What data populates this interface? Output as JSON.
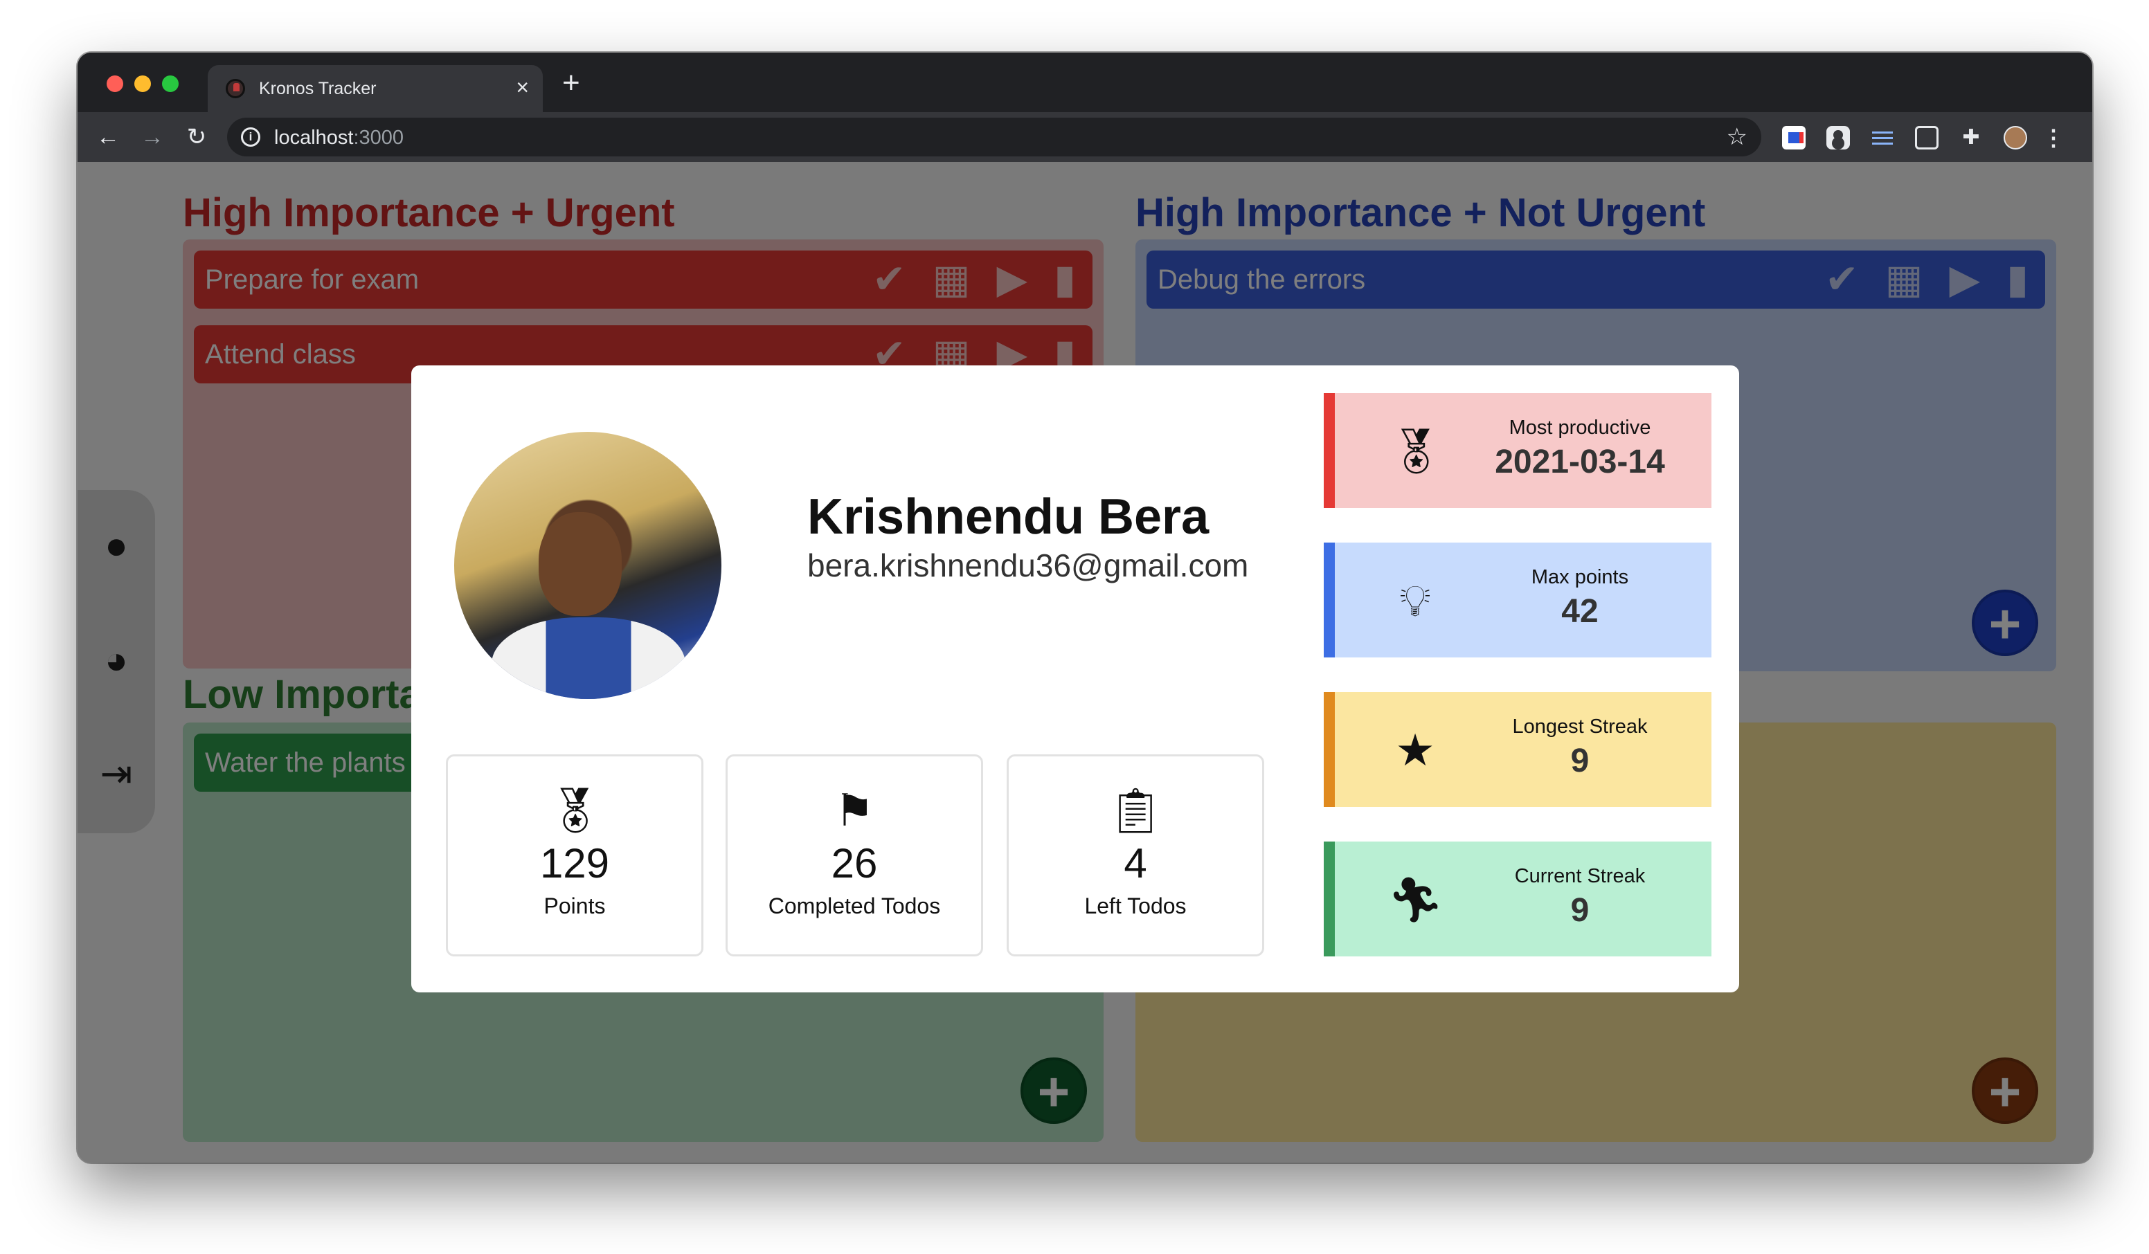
{
  "browser": {
    "tab_title": "Kronos Tracker",
    "tab_close": "×",
    "new_tab": "+",
    "url_host": "localhost",
    "url_port": ":3000"
  },
  "app": {
    "quadrants": [
      {
        "title": "High Importance + Urgent",
        "color": "#c62828",
        "todos": [
          "Prepare for exam",
          "Attend class"
        ]
      },
      {
        "title": "High Importance + Not Urgent",
        "color": "#2743b8",
        "todos": [
          "Debug the errors"
        ]
      },
      {
        "title": "Low Importa",
        "color": "#2e7d32",
        "todos": [
          "Water the plants"
        ]
      },
      {
        "title": "",
        "color": "#fbe59a",
        "todos": []
      }
    ],
    "todo_actions": [
      "done-icon",
      "calendar-icon",
      "play-icon",
      "trash-icon"
    ],
    "sidebar": [
      "profile-icon",
      "chart-icon",
      "logout-icon"
    ]
  },
  "profile": {
    "name": "Krishnendu Bera",
    "email": "bera.krishnendu36@gmail.com",
    "stats": [
      {
        "value": "129",
        "label": "Points",
        "icon": "medal-icon"
      },
      {
        "value": "26",
        "label": "Completed Todos",
        "icon": "checkered-flag-icon"
      },
      {
        "value": "4",
        "label": "Left Todos",
        "icon": "clipboard-list-icon"
      }
    ],
    "cards": [
      {
        "label": "Most productive",
        "value": "2021-03-14",
        "icon": "medal-icon",
        "accent": "#e53935"
      },
      {
        "label": "Max points",
        "value": "42",
        "icon": "lightbulb-icon",
        "accent": "#3d6ee4"
      },
      {
        "label": "Longest Streak",
        "value": "9",
        "icon": "star-icon",
        "accent": "#e08a1e"
      },
      {
        "label": "Current Streak",
        "value": "9",
        "icon": "running-icon",
        "accent": "#3a9a5c"
      }
    ]
  }
}
